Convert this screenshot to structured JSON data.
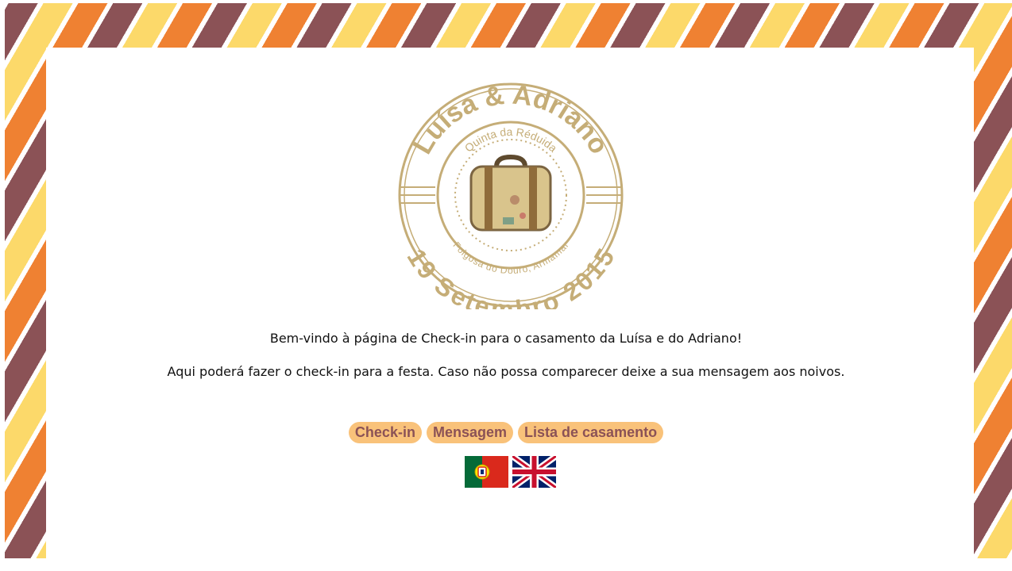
{
  "seal": {
    "names": "Luísa & Adriano",
    "venue": "Quinta da Réduida",
    "location": "Folgosa do Douro, Armamar",
    "date": "19 Setembro 2015",
    "icon": "suitcase-icon"
  },
  "content": {
    "welcome": "Bem-vindo à página de Check-in para o casamento da Luísa e do Adriano!",
    "info": "Aqui poderá fazer o check-in para a festa. Caso não possa comparecer deixe a sua mensagem aos noivos."
  },
  "nav": {
    "checkin": "Check-in",
    "message": "Mensagem",
    "registry": "Lista de casamento"
  },
  "languages": {
    "pt": "portugal-flag-icon",
    "en": "uk-flag-icon"
  },
  "colors": {
    "stripe_yellow": "#fcd96a",
    "stripe_plum": "#8b5256",
    "stripe_orange": "#ef8132",
    "button_bg": "#f9c27a",
    "button_text": "#8b5256",
    "seal_gold": "#c5ad77"
  }
}
